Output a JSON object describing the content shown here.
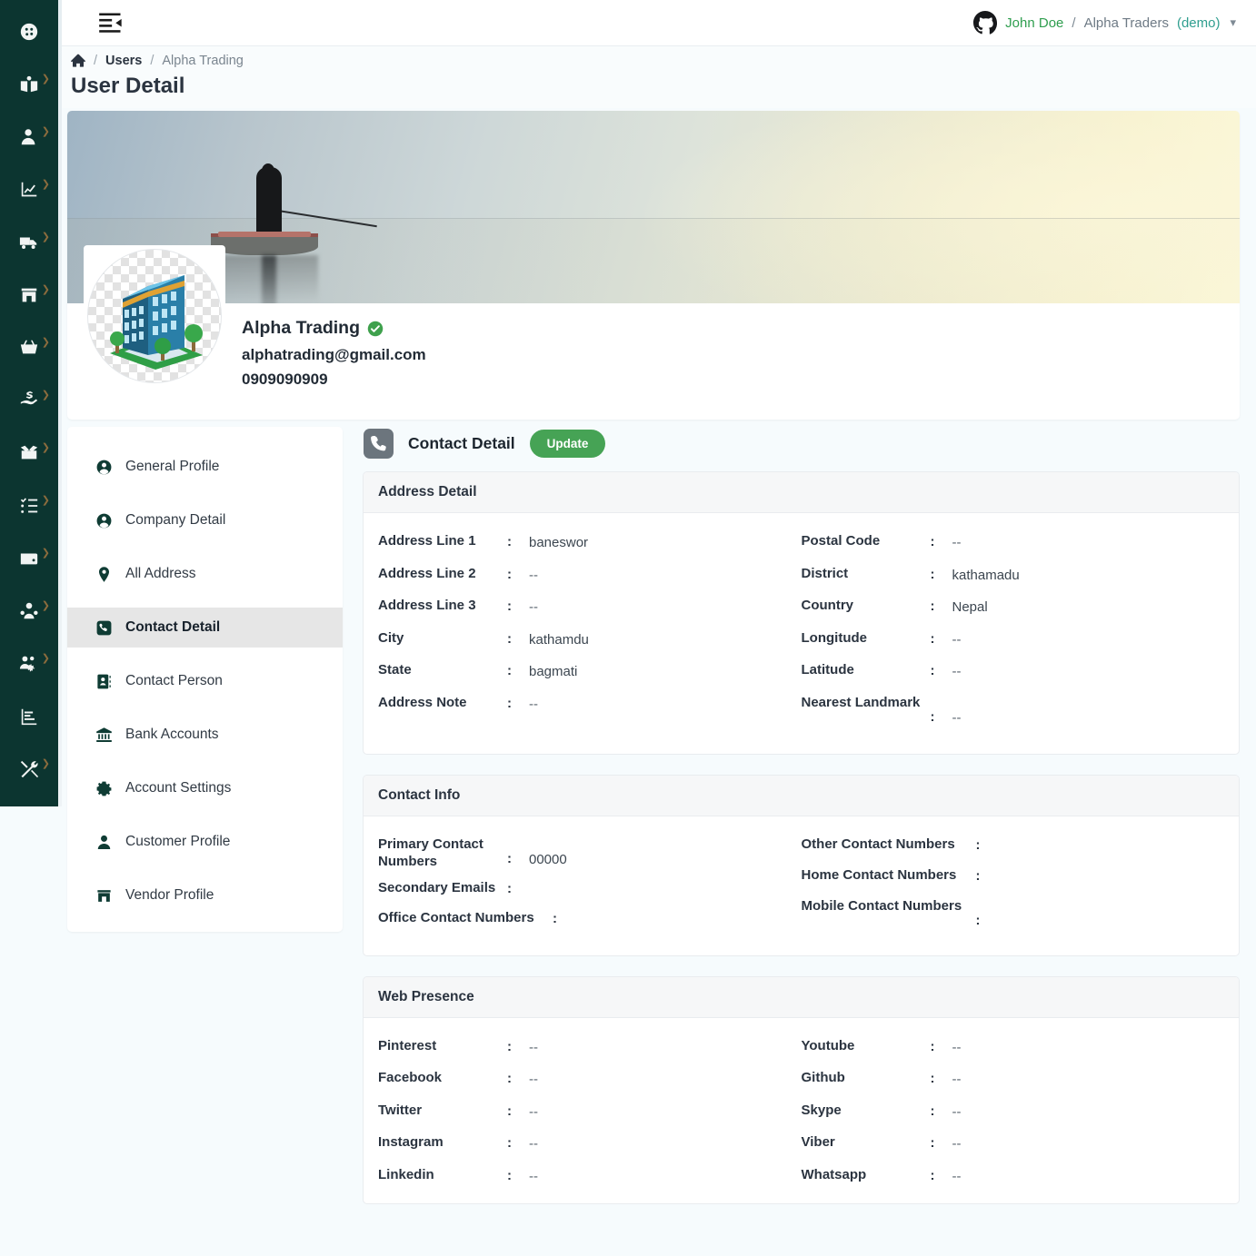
{
  "rail": {
    "items": [
      {
        "name": "dashboard",
        "icon": "gauge-icon",
        "caret": false
      },
      {
        "name": "catalog",
        "icon": "book-user-icon",
        "caret": true
      },
      {
        "name": "users",
        "icon": "user-arrow-icon",
        "caret": true
      },
      {
        "name": "reports",
        "icon": "chart-line-icon",
        "caret": true
      },
      {
        "name": "delivery",
        "icon": "truck-icon",
        "caret": true
      },
      {
        "name": "store",
        "icon": "storefront-icon",
        "caret": true
      },
      {
        "name": "sales",
        "icon": "basket-icon",
        "caret": true
      },
      {
        "name": "payments",
        "icon": "hand-dollar-icon",
        "caret": true
      },
      {
        "name": "inventory",
        "icon": "open-box-icon",
        "caret": true
      },
      {
        "name": "tasks",
        "icon": "checklist-icon",
        "caret": true
      },
      {
        "name": "wallet",
        "icon": "wallet-icon",
        "caret": true
      },
      {
        "name": "customers",
        "icon": "user-group-icon",
        "caret": true
      },
      {
        "name": "team-settings",
        "icon": "users-gear-icon",
        "caret": true
      },
      {
        "name": "analytics",
        "icon": "bar-chart-icon",
        "caret": false
      },
      {
        "name": "tools",
        "icon": "tools-icon",
        "caret": true
      }
    ]
  },
  "topbar": {
    "collapse_icon": "list-collapse-icon",
    "account": {
      "avatar_icon": "github-icon",
      "user_name": "John Doe",
      "separator": "/",
      "org_name": "Alpha Traders",
      "org_mode": "(demo)",
      "chevron": "chevron-down-icon"
    }
  },
  "breadcrumb": {
    "home_icon": "home-icon",
    "slash": "/",
    "items": [
      "Users",
      "Alpha Trading"
    ]
  },
  "page": {
    "title": "User Detail"
  },
  "profile": {
    "banner_alt": "fisherman-on-boat-banner",
    "avatar_alt": "office-building-avatar",
    "name": "Alpha Trading",
    "verified_icon": "verified-check-icon",
    "email": "alphatrading@gmail.com",
    "phone": "0909090909"
  },
  "subnav": {
    "items": [
      {
        "label": "General Profile",
        "icon": "user-circle-icon",
        "active": false
      },
      {
        "label": "Company Detail",
        "icon": "user-circle-icon",
        "active": false
      },
      {
        "label": "All Address",
        "icon": "map-pin-icon",
        "active": false
      },
      {
        "label": "Contact Detail",
        "icon": "phone-square-icon",
        "active": true
      },
      {
        "label": "Contact Person",
        "icon": "contact-book-icon",
        "active": false
      },
      {
        "label": "Bank Accounts",
        "icon": "bank-icon",
        "active": false
      },
      {
        "label": "Account Settings",
        "icon": "gear-icon",
        "active": false
      },
      {
        "label": "Customer Profile",
        "icon": "user-icon",
        "active": false
      },
      {
        "label": "Vendor Profile",
        "icon": "storefront-icon",
        "active": false
      }
    ]
  },
  "content": {
    "icon": "phone-icon",
    "title": "Contact Detail",
    "update_label": "Update",
    "panels": [
      {
        "title": "Address Detail",
        "left": [
          {
            "label": "Address Line 1",
            "value": "baneswor"
          },
          {
            "label": "Address Line 2",
            "value": "--"
          },
          {
            "label": "Address Line 3",
            "value": "--"
          },
          {
            "label": "City",
            "value": "kathamdu"
          },
          {
            "label": "State",
            "value": "bagmati"
          },
          {
            "label": "Address Note",
            "value": "--"
          }
        ],
        "right": [
          {
            "label": "Postal Code",
            "value": "--"
          },
          {
            "label": "District",
            "value": "kathamadu"
          },
          {
            "label": "Country",
            "value": "Nepal"
          },
          {
            "label": "Longitude",
            "value": "--"
          },
          {
            "label": "Latitude",
            "value": "--"
          },
          {
            "label": "Nearest Landmark",
            "value": "--",
            "tall": true
          }
        ]
      },
      {
        "title": "Contact Info",
        "left": [
          {
            "label": "Primary Contact Numbers",
            "value": "00000",
            "tall": true
          },
          {
            "label": "Secondary Emails",
            "value": ""
          },
          {
            "label": "Office Contact Numbers",
            "value": "",
            "wide": true
          }
        ],
        "right": [
          {
            "label": "Other Contact Numbers",
            "value": "",
            "wide": true
          },
          {
            "label": "Home Contact Numbers",
            "value": "",
            "wide": true
          },
          {
            "label": "Mobile Contact Numbers",
            "value": "",
            "wide": true,
            "tall": true
          }
        ]
      },
      {
        "title": "Web Presence",
        "left": [
          {
            "label": "Pinterest",
            "value": "--"
          },
          {
            "label": "Facebook",
            "value": "--"
          },
          {
            "label": "Twitter",
            "value": "--"
          },
          {
            "label": "Instagram",
            "value": "--"
          },
          {
            "label": "Linkedin",
            "value": "--"
          }
        ],
        "right": [
          {
            "label": "Youtube",
            "value": "--"
          },
          {
            "label": "Github",
            "value": "--"
          },
          {
            "label": "Skype",
            "value": "--"
          },
          {
            "label": "Viber",
            "value": "--"
          },
          {
            "label": "Whatsapp",
            "value": "--"
          }
        ]
      }
    ]
  },
  "colors": {
    "rail_bg": "#0c3530",
    "accent_green": "#46a355",
    "verified_green": "#3fa14d",
    "page_bg": "#f6fbfd",
    "panel_head": "#f6f7f8",
    "active_nav": "#e6e6e6",
    "badge_gray": "#6c757d",
    "user_name_green": "#2f9e4f",
    "demo_teal": "#2f9e8f"
  }
}
